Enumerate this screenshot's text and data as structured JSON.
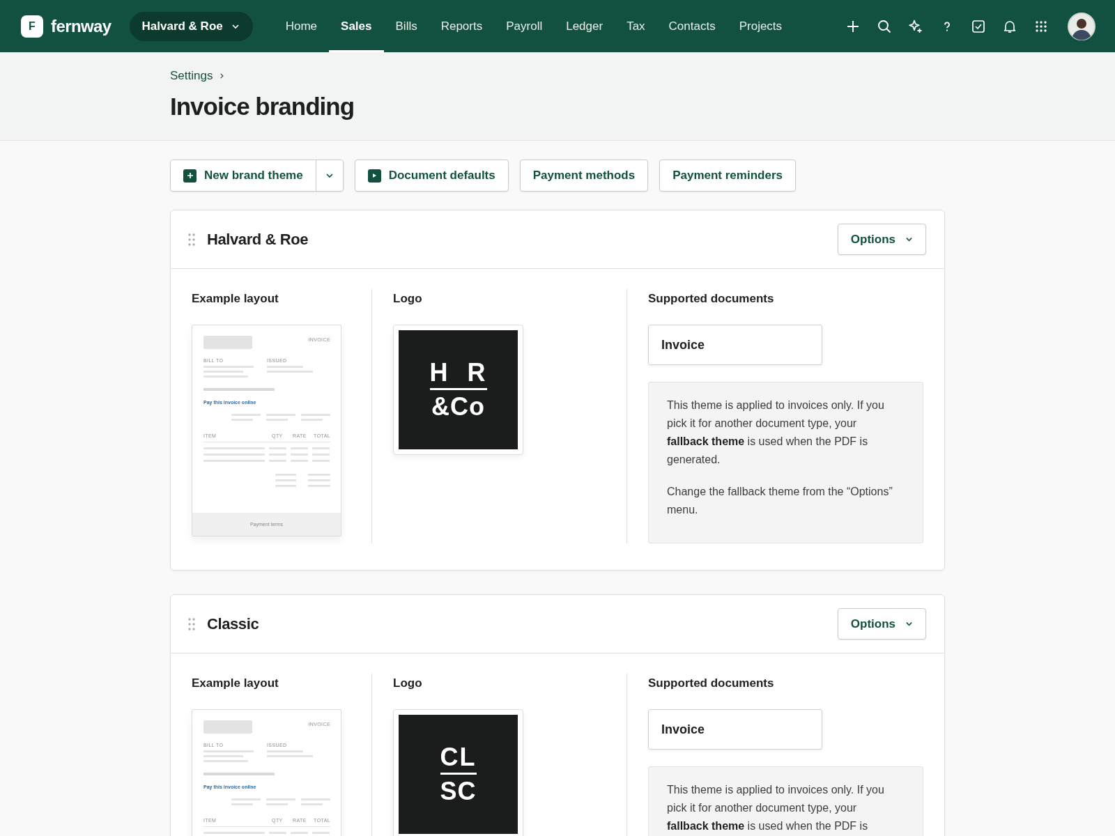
{
  "brand": {
    "letter": "F",
    "name": "fernway"
  },
  "org_switcher": {
    "label": "Halvard & Roe"
  },
  "nav": [
    {
      "label": "Home",
      "selected": false
    },
    {
      "label": "Sales",
      "selected": true
    },
    {
      "label": "Bills",
      "selected": false
    },
    {
      "label": "Reports",
      "selected": false
    },
    {
      "label": "Payroll",
      "selected": false
    },
    {
      "label": "Ledger",
      "selected": false
    },
    {
      "label": "Tax",
      "selected": false
    },
    {
      "label": "Contacts",
      "selected": false
    },
    {
      "label": "Projects",
      "selected": false
    }
  ],
  "breadcrumb": [
    "Settings"
  ],
  "title": "Invoice branding",
  "actions": [
    {
      "label": "New brand theme",
      "kind": "split"
    },
    {
      "label": "Document defaults",
      "kind": "plain"
    },
    {
      "label": "Payment methods",
      "kind": "plain"
    },
    {
      "label": "Payment reminders",
      "kind": "plain"
    }
  ],
  "themes": [
    {
      "name": "Halvard & Roe",
      "options": "Options",
      "layout_label": "Example layout",
      "logo_label": "Logo",
      "documents_label": "Supported documents",
      "preview": {
        "title": "INVOICE",
        "bill_to": "BILL TO",
        "issued": "ISSUED",
        "pay_link": "Pay this invoice online",
        "columns": [
          "ITEM",
          "QTY",
          "RATE",
          "TOTAL"
        ],
        "footer": "Payment terms"
      },
      "logo": {
        "top": "H R",
        "bottom": "&Co"
      },
      "documents": [
        "Invoice"
      ],
      "note": [
        "This theme is applied to invoices only. If you pick it for another document type, your **fallback theme** is used when the PDF is generated.",
        "Change the fallback theme from the “Options” menu."
      ]
    },
    {
      "name": "Classic",
      "options": "Options",
      "layout_label": "Example layout",
      "logo_label": "Logo",
      "documents_label": "Supported documents",
      "preview": {
        "title": "INVOICE",
        "bill_to": "BILL TO",
        "issued": "ISSUED",
        "pay_link": "Pay this invoice online",
        "columns": [
          "ITEM",
          "QTY",
          "RATE",
          "TOTAL"
        ]
      },
      "logo": {
        "top": "CL",
        "bottom": "SC"
      },
      "documents": [
        "Invoice"
      ],
      "note": [
        "This theme is applied to invoices only. If you pick it for another document type, your **fallback theme** is used when the PDF is"
      ]
    }
  ]
}
